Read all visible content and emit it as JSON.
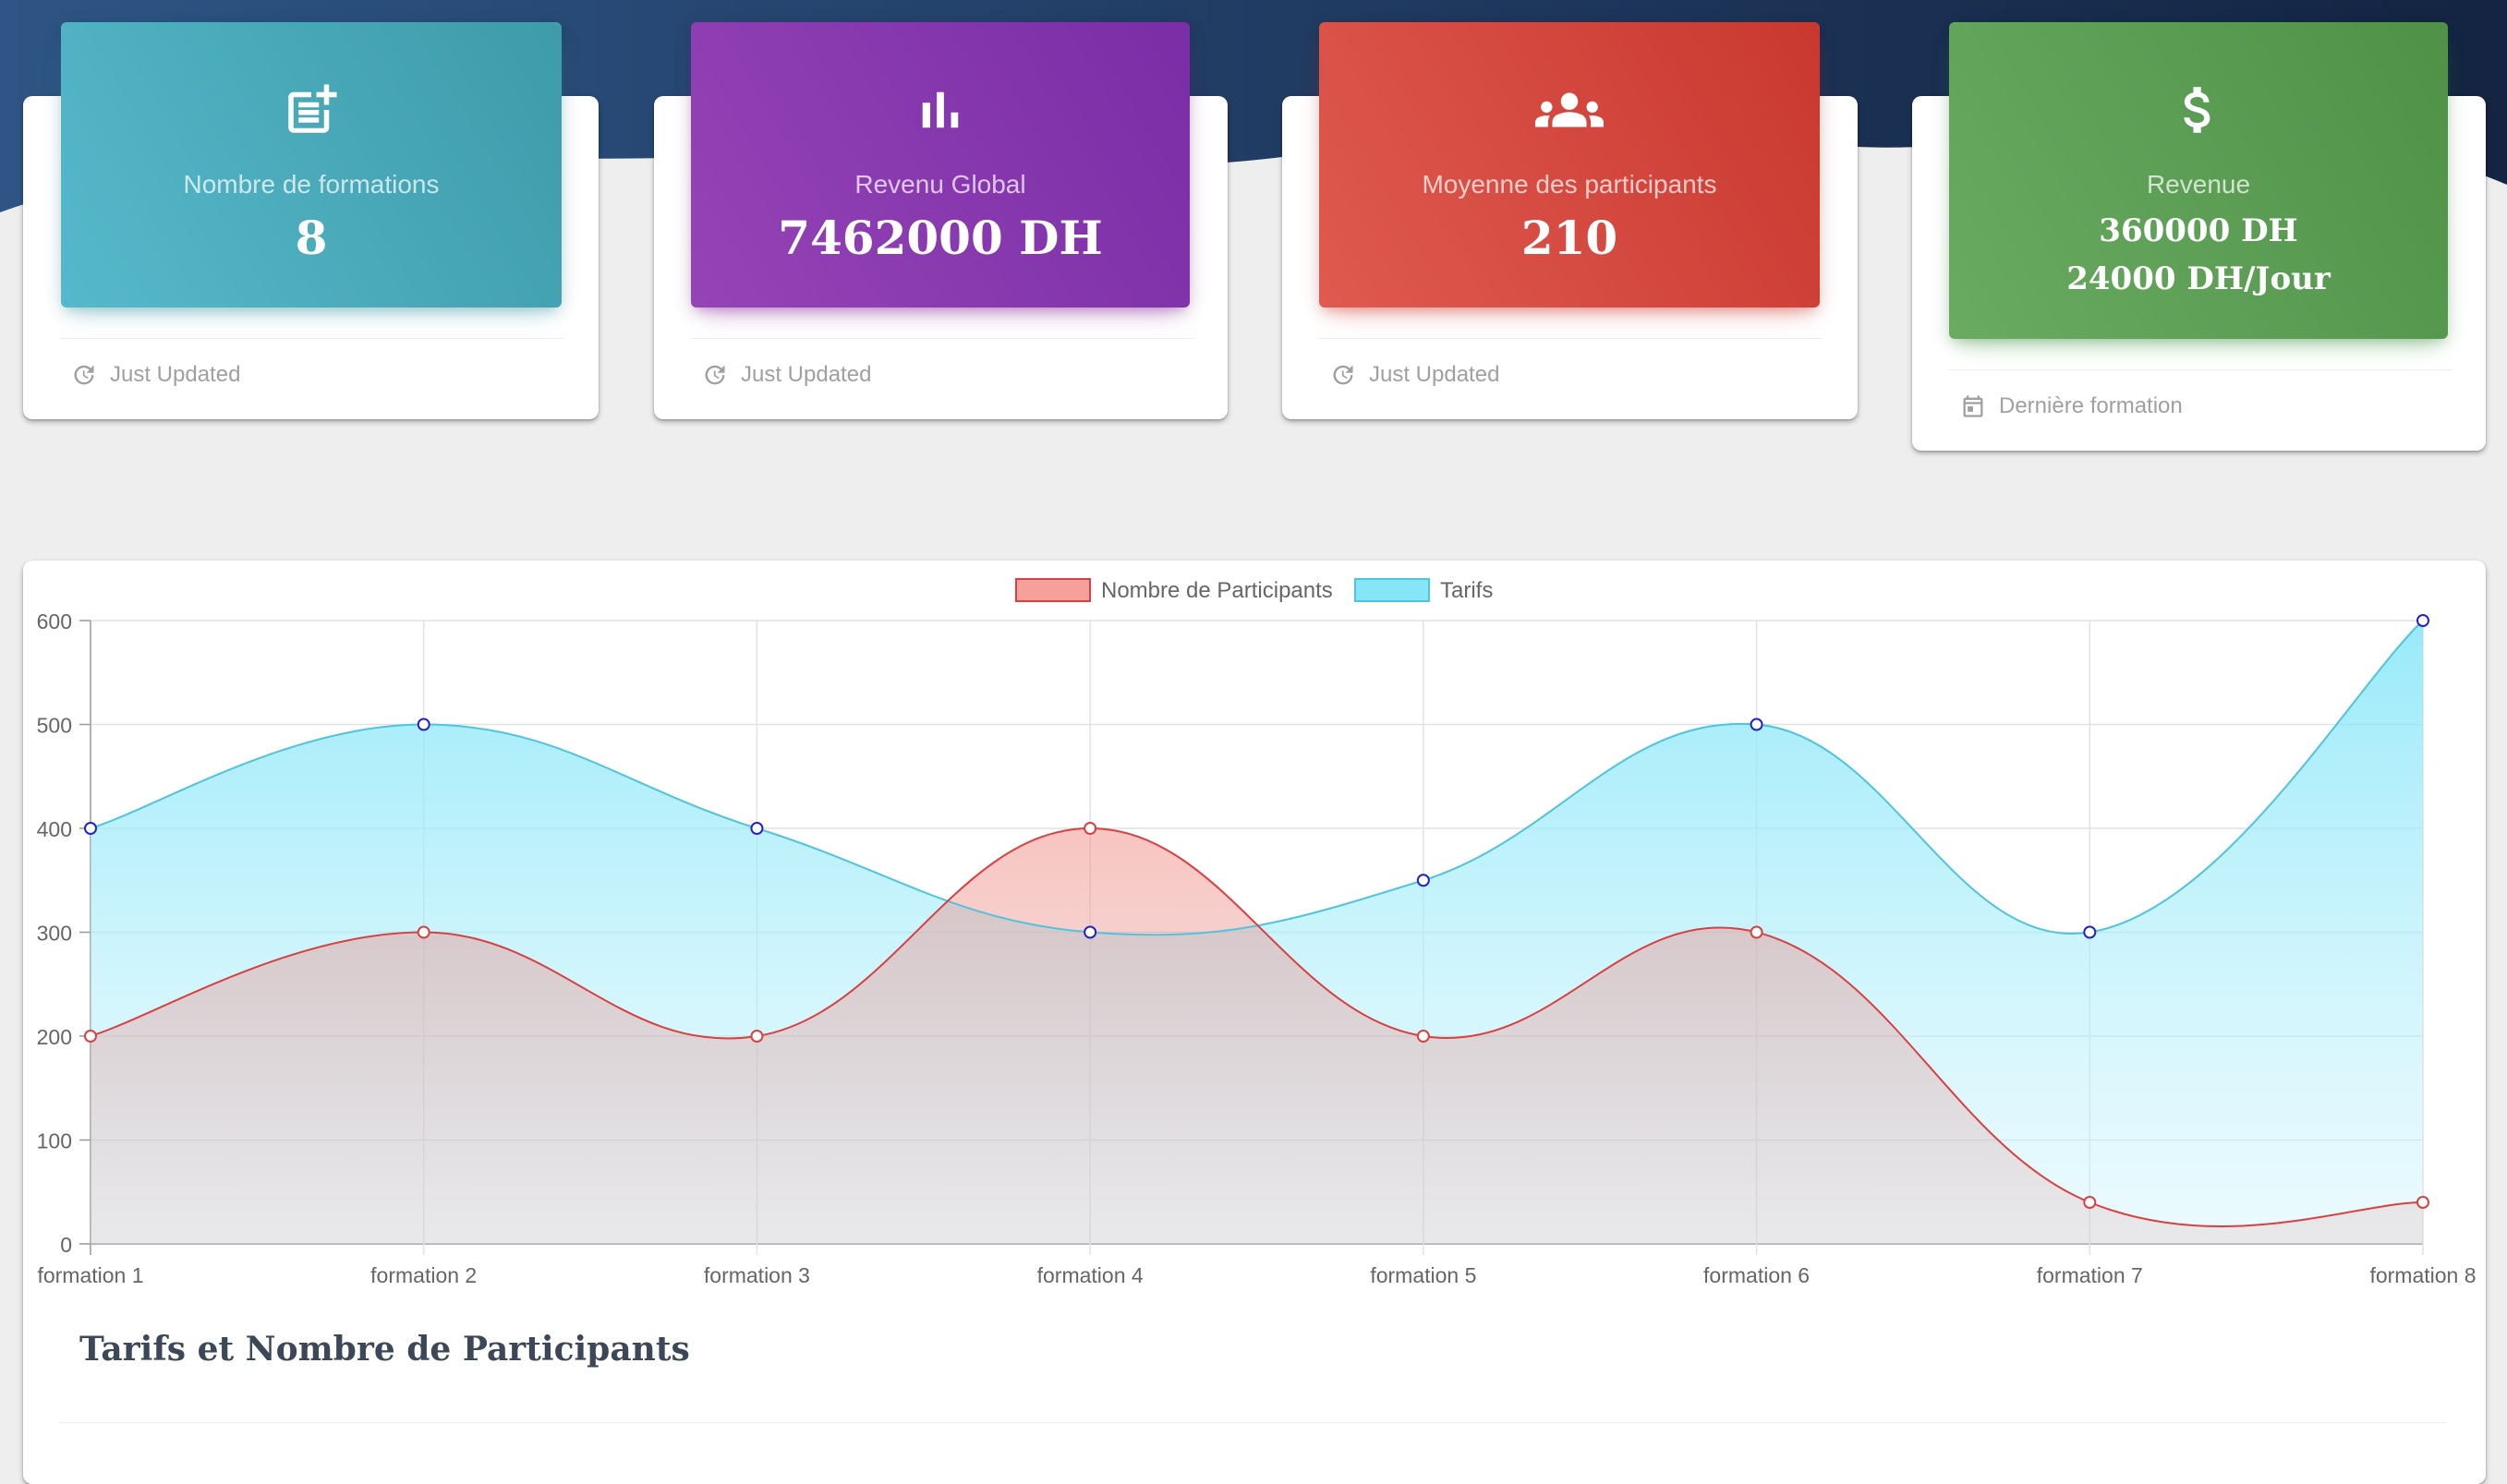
{
  "stats": [
    {
      "icon": "post-add-icon",
      "label": "Nombre de formations",
      "value": "8",
      "footer_icon": "update-icon",
      "footer": "Just Updated"
    },
    {
      "icon": "bar-chart-icon",
      "label": "Revenu Global",
      "value": "7462000 DH",
      "footer_icon": "update-icon",
      "footer": "Just Updated"
    },
    {
      "icon": "groups-icon",
      "label": "Moyenne des participants",
      "value": "210",
      "footer_icon": "update-icon",
      "footer": "Just Updated"
    },
    {
      "icon": "dollar-icon",
      "label": "Revenue",
      "value": "360000 DH",
      "value2": "24000 DH/Jour",
      "footer_icon": "calendar-icon",
      "footer": "Dernière formation"
    }
  ],
  "colors": {
    "info": "#4ab3c5",
    "purple": "#8a3bb0",
    "danger": "#d9463c",
    "success": "#5aa053",
    "participants_line": "#d94040",
    "tarifs_line": "#4fc4dc"
  },
  "chart_title": "Tarifs et Nombre de Participants",
  "chart_data": {
    "type": "area",
    "categories": [
      "formation 1",
      "formation 2",
      "formation 3",
      "formation 4",
      "formation 5",
      "formation 6",
      "formation 7",
      "formation 8"
    ],
    "series": [
      {
        "name": "Nombre de Participants",
        "values": [
          200,
          300,
          200,
          400,
          200,
          300,
          40,
          40
        ]
      },
      {
        "name": "Tarifs",
        "values": [
          400,
          500,
          400,
          300,
          350,
          500,
          300,
          600
        ]
      }
    ],
    "ylim": [
      0,
      600
    ],
    "yticks": [
      0,
      100,
      200,
      300,
      400,
      500,
      600
    ],
    "grid": true,
    "legend": "top-center"
  }
}
